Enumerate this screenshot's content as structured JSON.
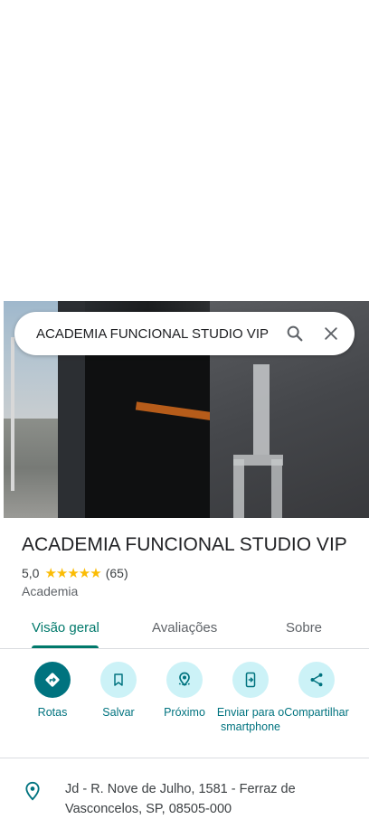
{
  "search": {
    "query": "ACADEMIA FUNCIONAL STUDIO VIP",
    "search_icon": "search-icon",
    "close_icon": "close-icon"
  },
  "place": {
    "name": "ACADEMIA FUNCIONAL STUDIO VIP",
    "rating": "5,0",
    "stars": "★★★★★",
    "review_count": "(65)",
    "category": "Academia"
  },
  "tabs": [
    {
      "label": "Visão geral",
      "active": true
    },
    {
      "label": "Avaliações",
      "active": false
    },
    {
      "label": "Sobre",
      "active": false
    }
  ],
  "actions": [
    {
      "label": "Rotas",
      "icon": "directions-icon"
    },
    {
      "label": "Salvar",
      "icon": "bookmark-icon"
    },
    {
      "label": "Próximo",
      "icon": "nearby-icon"
    },
    {
      "label": "Enviar para o smartphone",
      "icon": "send-to-phone-icon"
    },
    {
      "label": "Compartilhar",
      "icon": "share-icon"
    }
  ],
  "address": {
    "text": "Jd - R. Nove de Julho, 1581 - Ferraz de Vasconcelos, SP, 08505-000",
    "icon": "location-pin-icon"
  },
  "colors": {
    "accent": "#00737f",
    "tab_active": "#00796b",
    "action_bg": "#ccf2f7",
    "star": "#fbbc04"
  }
}
